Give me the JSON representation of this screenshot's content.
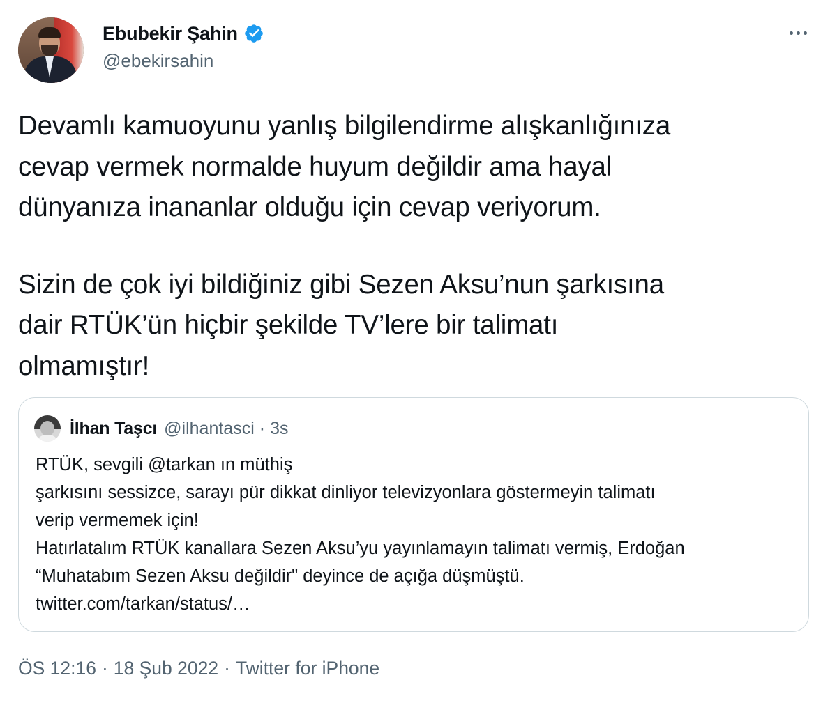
{
  "author": {
    "display_name": "Ebubekir Şahin",
    "handle": "@ebekirsahin",
    "verified": true,
    "avatar_icon": "profile-photo",
    "verified_icon": "verified-badge-icon",
    "verified_color": "#1d9bf0"
  },
  "more_icon": "more-horizontal-icon",
  "tweet": {
    "paragraphs": [
      "Devamlı kamuoyunu yanlış bilgilendirme alışkanlığınıza\ncevap vermek normalde huyum değildir ama hayal\ndünyanıza inananlar olduğu için cevap veriyorum.",
      "Sizin de çok iyi bildiğiniz gibi Sezen Aksu’nun şarkısına\ndair RTÜK’ün hiçbir şekilde TV’lere bir talimatı\nolmamıştır!"
    ]
  },
  "quoted_tweet": {
    "display_name": "İlhan Taşcı",
    "handle": "@ilhantasci",
    "separator": "·",
    "time": "3s",
    "avatar_icon": "profile-photo",
    "lines": [
      "RTÜK, sevgili @tarkan ın müthiş",
      "şarkısını sessizce, sarayı pür dikkat dinliyor televizyonlara göstermeyin talimatı",
      "verip vermemek için!",
      "Hatırlatalım RTÜK kanallara Sezen Aksu’yu yayınlamayın talimatı vermiş, Erdoğan",
      "“Muhatabım Sezen Aksu değildir\" deyince de açığa düşmüştü.",
      "twitter.com/tarkan/status/…"
    ]
  },
  "meta": {
    "time": "ÖS 12:16",
    "sep1": "·",
    "date": "18 Şub 2022",
    "sep2": "·",
    "source": "Twitter for iPhone"
  },
  "colors": {
    "text_primary": "#0f1419",
    "text_secondary": "#536471",
    "border": "#cfd9de",
    "accent": "#1d9bf0"
  }
}
